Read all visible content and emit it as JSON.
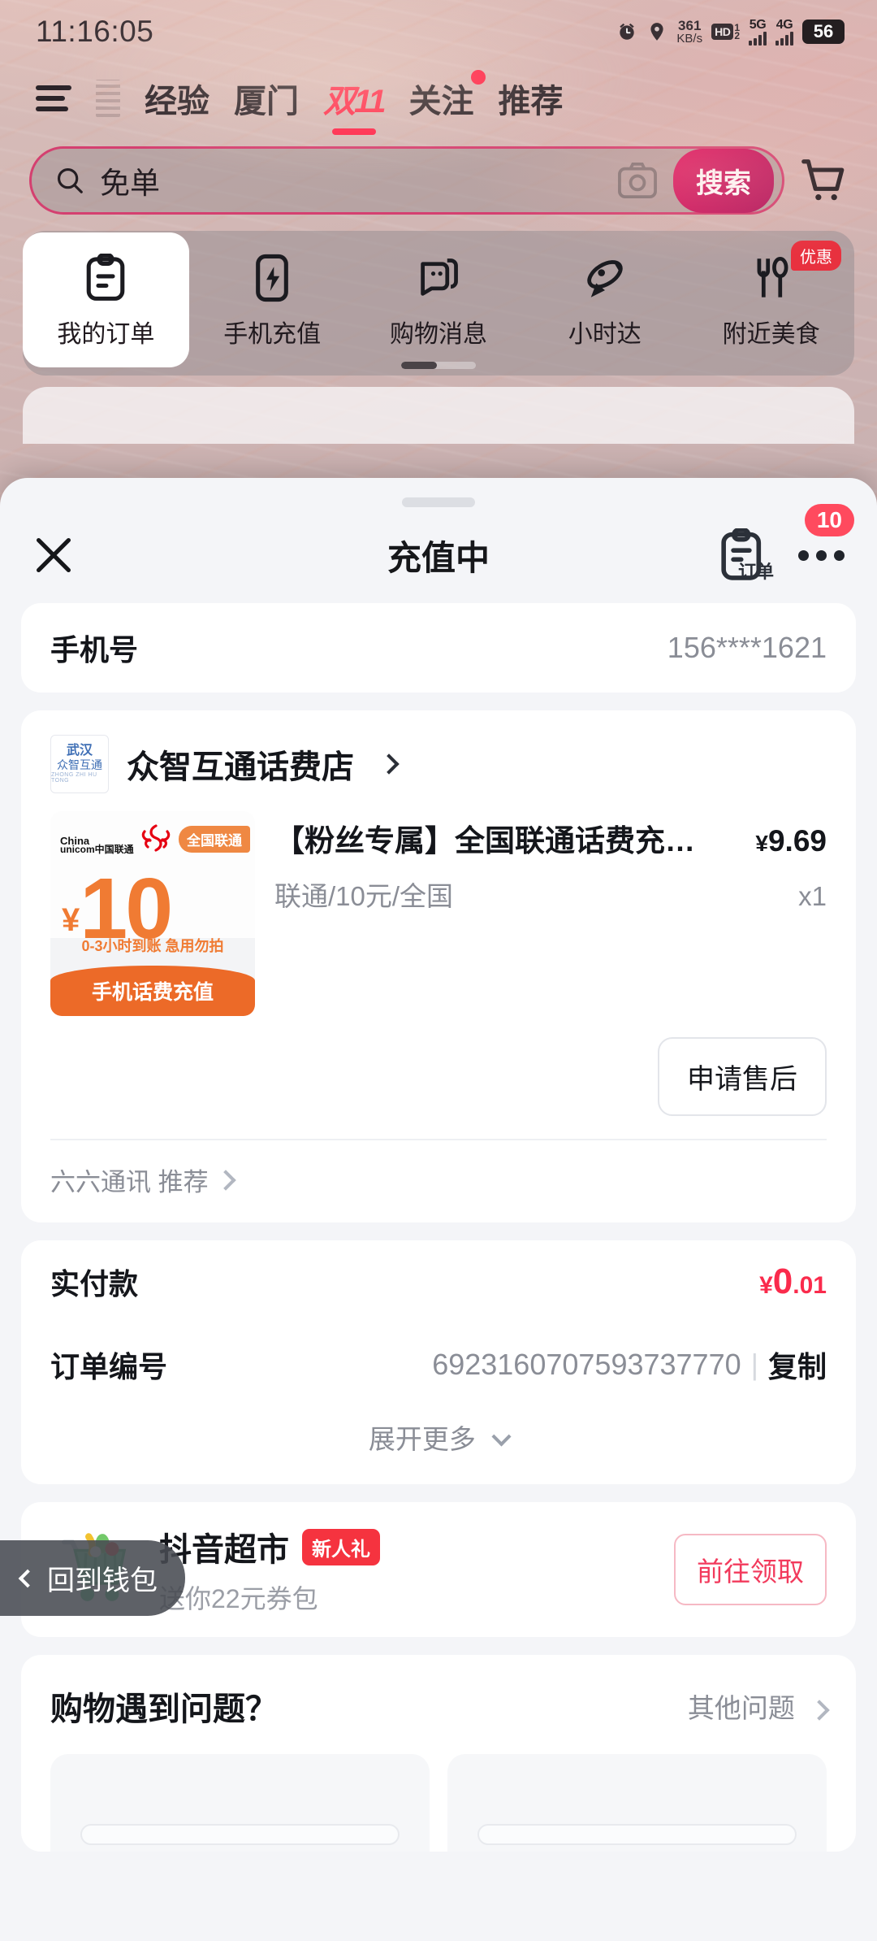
{
  "status_bar": {
    "time": "11:16:05",
    "network_speed": "361",
    "network_speed_unit": "KB/s",
    "hd_label": "HD",
    "hd_sim_top": "1",
    "hd_sim_bottom": "2",
    "net_5g": "5G",
    "net_4g": "4G",
    "battery": "56"
  },
  "top_nav": {
    "tabs": [
      {
        "label": "经验",
        "active": false
      },
      {
        "label": "厦门",
        "active": false
      },
      {
        "label": "双11",
        "active": true
      },
      {
        "label": "关注",
        "active": false,
        "dot": true
      },
      {
        "label": "推荐",
        "active": false
      }
    ]
  },
  "search": {
    "query": "免单",
    "placeholder": "免单",
    "button_label": "搜索"
  },
  "quick_entries": [
    {
      "label": "我的订单",
      "icon": "clipboard-icon",
      "active": true
    },
    {
      "label": "手机充值",
      "icon": "phone-charge-icon",
      "active": false
    },
    {
      "label": "购物消息",
      "icon": "shopping-message-icon",
      "active": false
    },
    {
      "label": "小时达",
      "icon": "rocket-icon",
      "active": false
    },
    {
      "label": "附近美食",
      "icon": "fork-spoon-icon",
      "active": false,
      "badge": "优惠"
    }
  ],
  "sheet": {
    "title": "充值中",
    "orders_label": "订单",
    "orders_badge": "10",
    "phone_row": {
      "label": "手机号",
      "value": "156****1621"
    },
    "shop": {
      "logo_top": "武汉",
      "logo_main": "众智互通",
      "logo_sub": "ZHONG ZHI HU TONG",
      "name": "众智互通话费店"
    },
    "product": {
      "image": {
        "brand_cn": "中国联通",
        "brand_en_1": "China",
        "brand_en_2": "unicom",
        "badge": "全国联通",
        "currency": "¥",
        "amount": "10",
        "note": "0-3小时到账 急用勿拍",
        "footer": "手机话费充值"
      },
      "title": "【粉丝专属】全国联通话费充…",
      "price_currency": "¥",
      "price": "9.69",
      "spec": "联通/10元/全国",
      "qty": "x1"
    },
    "aftersale_button": "申请售后",
    "recommend": "六六通讯 推荐",
    "payment": {
      "label": "实付款",
      "currency": "¥",
      "amount_major": "0",
      "amount_minor": ".01",
      "order_no_label": "订单编号",
      "order_no": "6923160707593737770",
      "copy_label": "复制",
      "expand_label": "展开更多"
    },
    "promo": {
      "title": "抖音超市",
      "badge": "新人礼",
      "subtitle": "送你22元券包",
      "button": "前往领取"
    },
    "help": {
      "title": "购物遇到问题？",
      "more": "其他问题"
    }
  },
  "back_pill": {
    "label": "回到钱包"
  },
  "colors": {
    "accent_red": "#ff2d4b",
    "search_button": "#e0145f",
    "price_red": "#fa2b4c",
    "orange": "#ec6a28",
    "badge_red": "#f5333f"
  }
}
